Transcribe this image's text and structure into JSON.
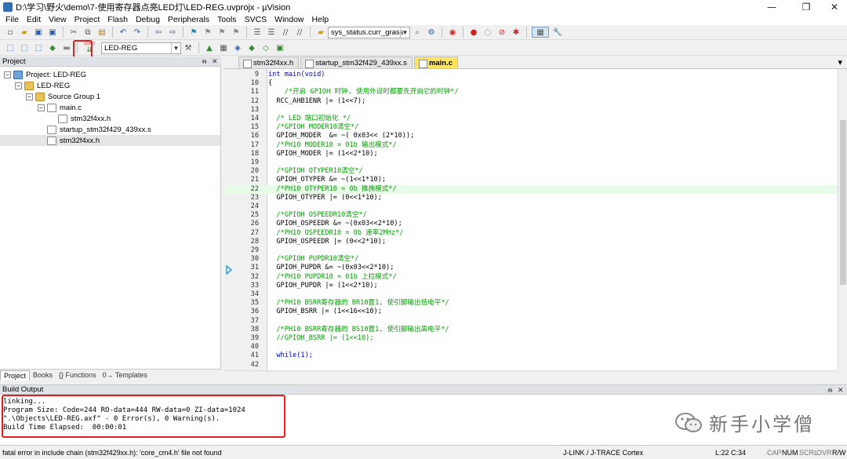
{
  "window": {
    "title": "D:\\学习\\野火\\demo\\7-使用寄存器点亮LED灯\\LED-REG.uvprojx - µVision",
    "minimize": "—",
    "maximize": "❐",
    "close": "✕"
  },
  "menu": [
    "File",
    "Edit",
    "View",
    "Project",
    "Flash",
    "Debug",
    "Peripherals",
    "Tools",
    "SVCS",
    "Window",
    "Help"
  ],
  "toolbar": {
    "find_combo_value": "sys_status.curr_grass",
    "target_combo_value": "LED-REG",
    "load_button_label": "LOAD"
  },
  "project_panel": {
    "header": "Project",
    "pin": "ᵰ",
    "close": "✕",
    "tree": [
      {
        "label": "Project: LED-REG",
        "kind": "proj",
        "toggle": "−"
      },
      {
        "label": "LED-REG",
        "kind": "folder",
        "toggle": "−"
      },
      {
        "label": "Source Group 1",
        "kind": "folder",
        "toggle": "−"
      },
      {
        "label": "main.c",
        "kind": "file",
        "toggle": "−"
      },
      {
        "label": "stm32f4xx.h",
        "kind": "file",
        "toggle": ""
      },
      {
        "label": "startup_stm32f429_439xx.s",
        "kind": "file",
        "toggle": ""
      },
      {
        "label": "stm32f4xx.h",
        "kind": "file",
        "toggle": ""
      }
    ],
    "tabs": [
      "Project",
      "Books",
      "{} Functions",
      "0→ Templates"
    ]
  },
  "editor": {
    "tabs": [
      "stm32f4xx.h",
      "startup_stm32f429_439xx.s",
      "main.c"
    ],
    "active_tab": "main.c",
    "lines": [
      {
        "n": "9",
        "code": "int main(void)"
      },
      {
        "n": "10",
        "code": "{"
      },
      {
        "n": "11",
        "code": "    /*开启 GPIOH 时钟, 使用外设时都要先开启它的时钟*/"
      },
      {
        "n": "12",
        "code": "  RCC_AHB1ENR |= (1<<7);"
      },
      {
        "n": "13",
        "code": ""
      },
      {
        "n": "14",
        "code": "  /* LED 端口初始化 */"
      },
      {
        "n": "15",
        "code": "  /*GPIOH MODER10清空*/"
      },
      {
        "n": "16",
        "code": "  GPIOH_MODER  &= ~( 0x03<< (2*10));"
      },
      {
        "n": "17",
        "code": "  /*PH10 MODER10 = 01b 输出模式*/"
      },
      {
        "n": "18",
        "code": "  GPIOH_MODER |= (1<<2*10);"
      },
      {
        "n": "19",
        "code": ""
      },
      {
        "n": "20",
        "code": "  /*GPIOH OTYPER10清空*/"
      },
      {
        "n": "21",
        "code": "  GPIOH_OTYPER &= ~(1<<1*10);"
      },
      {
        "n": "22",
        "code": "  /*PH10 OTYPER10 = 0b 推挽模式*/"
      },
      {
        "n": "23",
        "code": "  GPIOH_OTYPER |= (0<<1*10);"
      },
      {
        "n": "24",
        "code": ""
      },
      {
        "n": "25",
        "code": "  /*GPIOH OSPEEDR10清空*/"
      },
      {
        "n": "26",
        "code": "  GPIOH_OSPEEDR &= ~(0x03<<2*10);"
      },
      {
        "n": "27",
        "code": "  /*PH10 OSPEEDR10 = 0b 速率2MHz*/"
      },
      {
        "n": "28",
        "code": "  GPIOH_OSPEEDR |= (0<<2*10);"
      },
      {
        "n": "29",
        "code": ""
      },
      {
        "n": "30",
        "code": "  /*GPIOH PUPDR10清空*/"
      },
      {
        "n": "31",
        "code": "  GPIOH_PUPDR &= ~(0x03<<2*10);"
      },
      {
        "n": "32",
        "code": "  /*PH10 PUPDR10 = 01b 上拉模式*/"
      },
      {
        "n": "33",
        "code": "  GPIOH_PUPDR |= (1<<2*10);"
      },
      {
        "n": "34",
        "code": ""
      },
      {
        "n": "35",
        "code": "  /*PH10 BSRR寄存器的 BR10置1, 使引脚输出低电平*/"
      },
      {
        "n": "36",
        "code": "  GPIOH_BSRR |= (1<<16<<10);"
      },
      {
        "n": "37",
        "code": ""
      },
      {
        "n": "38",
        "code": "  /*PH10 BSRR寄存器的 BS10置1, 使引脚输出高电平*/"
      },
      {
        "n": "39",
        "code": "  //GPIOH_BSRR |= (1<<10);"
      },
      {
        "n": "40",
        "code": ""
      },
      {
        "n": "41",
        "code": "  while(1);"
      },
      {
        "n": "42",
        "code": ""
      }
    ],
    "highlighted_line": "22",
    "current_marker_line": "31",
    "close": "▾"
  },
  "build_output": {
    "header": "Build Output",
    "pin": "ᵰ",
    "close": "✕",
    "lines": [
      "linking...",
      "Program Size: Code=244 RO-data=444 RW-data=0 ZI-data=1024",
      "\".\\Objects\\LED-REG.axf\" - 0 Error(s), 0 Warning(s).",
      "Build Time Elapsed:  00:00:01"
    ]
  },
  "watermark": "新手小学僧",
  "statusbar": {
    "message": "fatal error in include chain (stm32f429xx.h): 'core_cm4.h' file not found",
    "debugger": "J-LINK / J-TRACE Cortex",
    "position": "L:22 C:34",
    "caps": "CAP",
    "num": "NUM",
    "scrl": "SCRL",
    "ovr": "OVR",
    "rw": "R/W"
  },
  "colors": {
    "highlight_box": "#e02020",
    "active_tab": "#ffe55c",
    "comment": "#00a000",
    "keyword": "#0000d0",
    "current_line": "#e8fbe8"
  }
}
